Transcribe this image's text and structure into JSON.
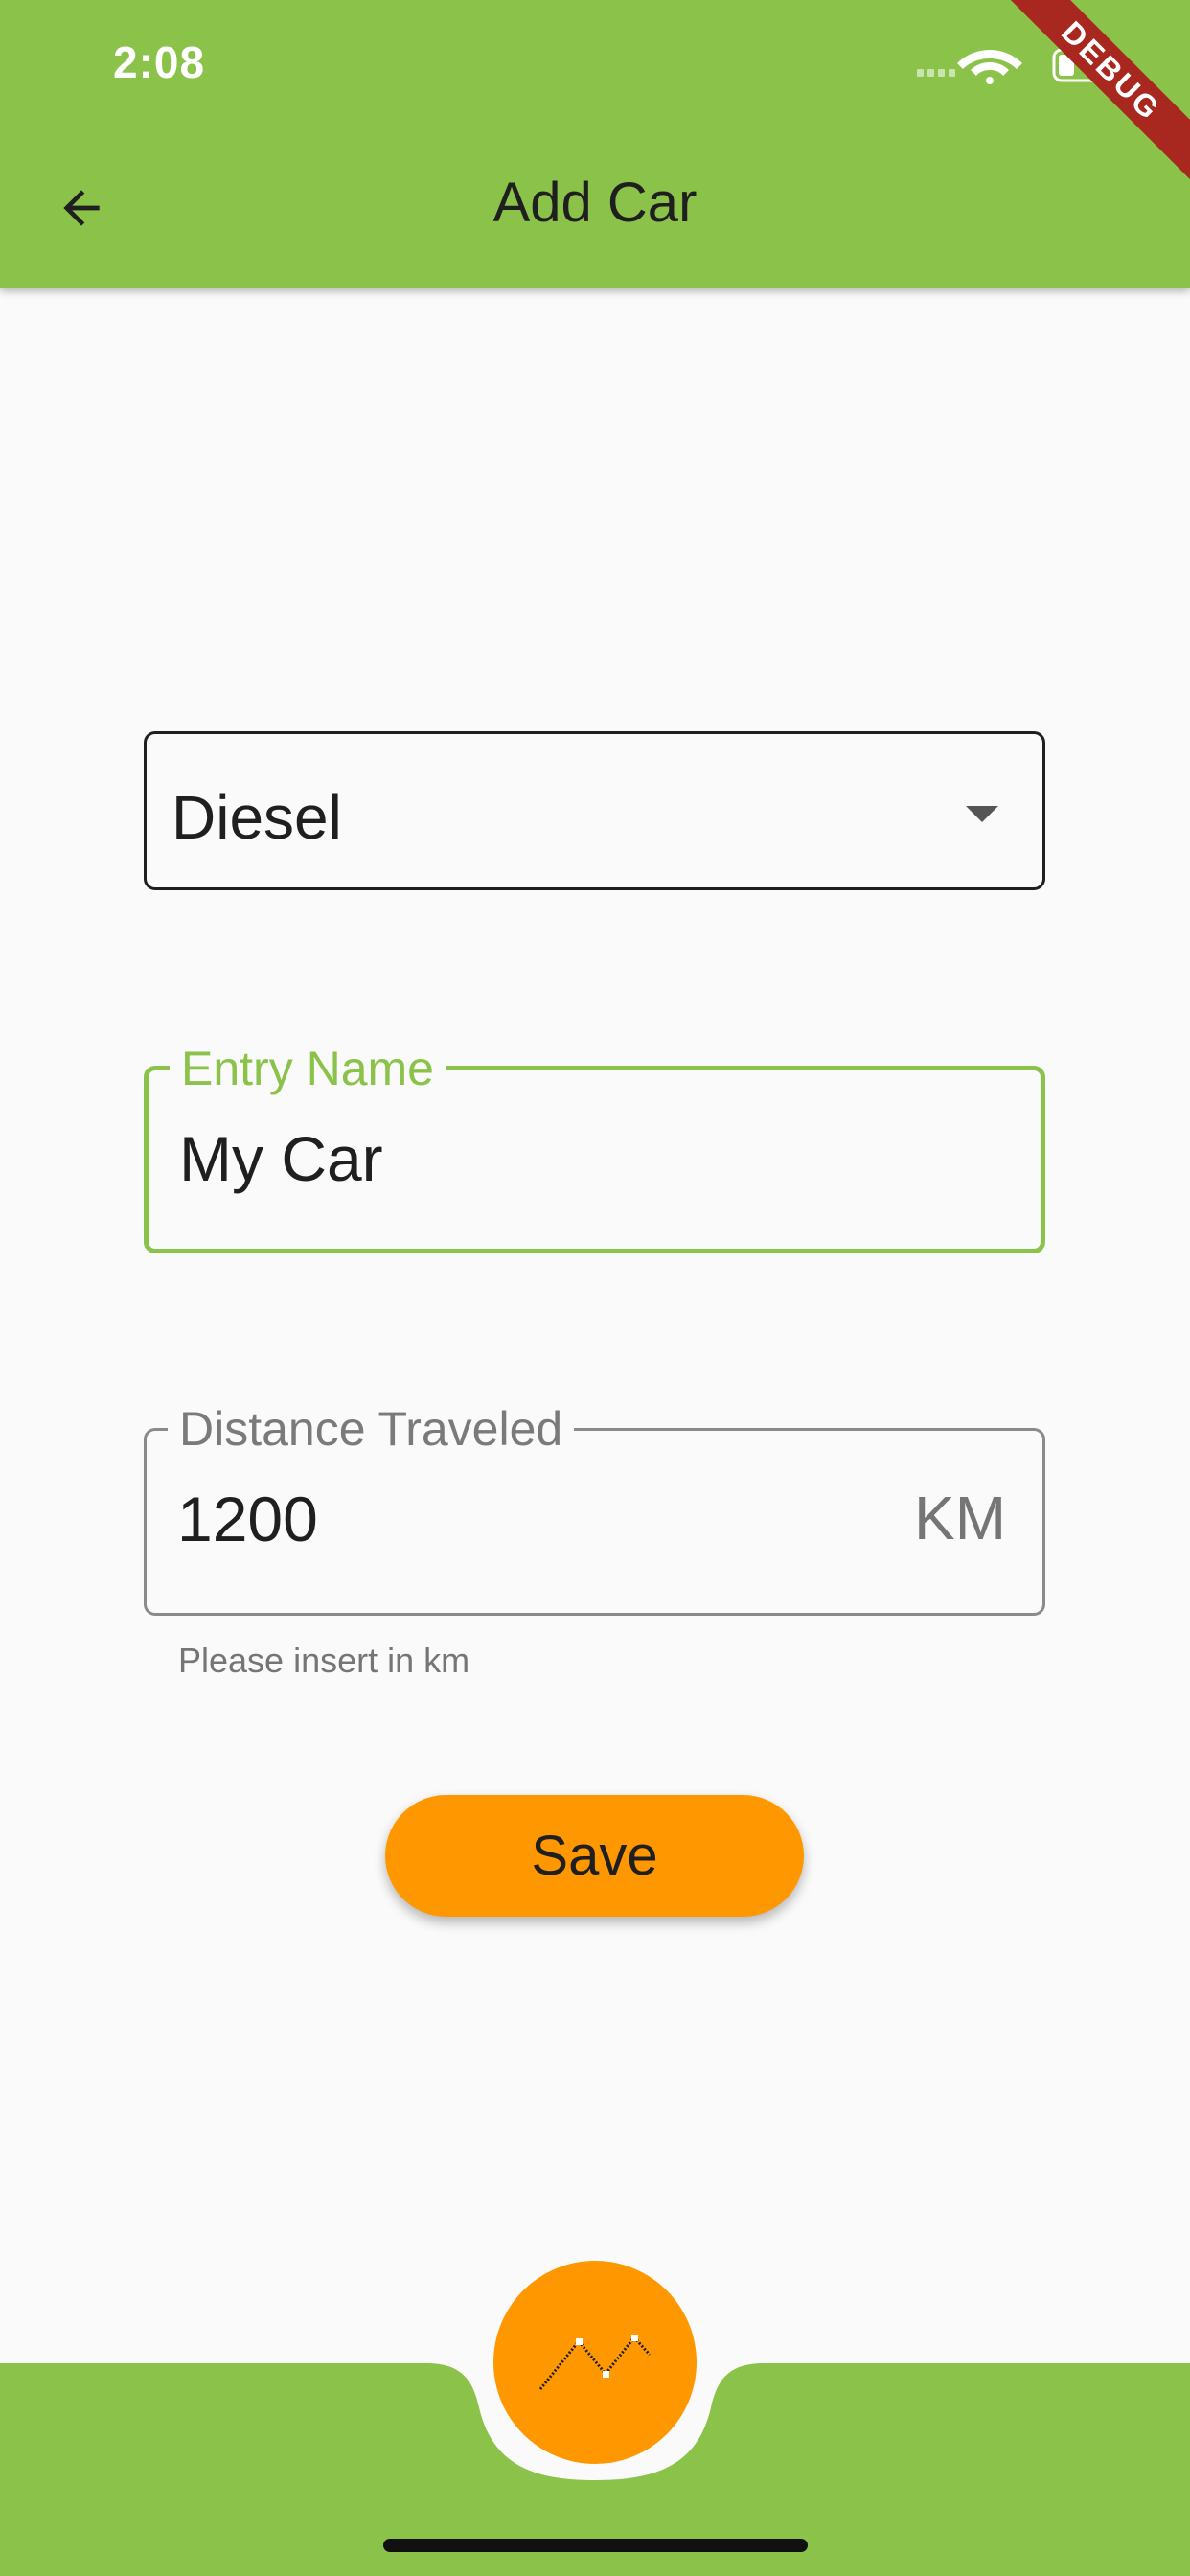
{
  "status_bar": {
    "time": "2:08"
  },
  "app_bar": {
    "title": "Add Car",
    "back_icon": "arrow-back-icon",
    "debug_banner": "DEBUG"
  },
  "form": {
    "fuel_dropdown": {
      "selected": "Diesel",
      "icon": "arrow-drop-down-icon"
    },
    "entry_name": {
      "label": "Entry Name",
      "value": "My Car",
      "state": "focused"
    },
    "distance": {
      "label": "Distance Traveled",
      "value": "1200",
      "suffix": "KM",
      "helper": "Please insert in km"
    },
    "save_label": "Save"
  },
  "bottom_nav": {
    "fab_icon": "line-chart-icon"
  },
  "colors": {
    "primary": "#8bc34a",
    "accent": "#ff9800",
    "background": "#fafafa",
    "debug": "#a8281f"
  }
}
